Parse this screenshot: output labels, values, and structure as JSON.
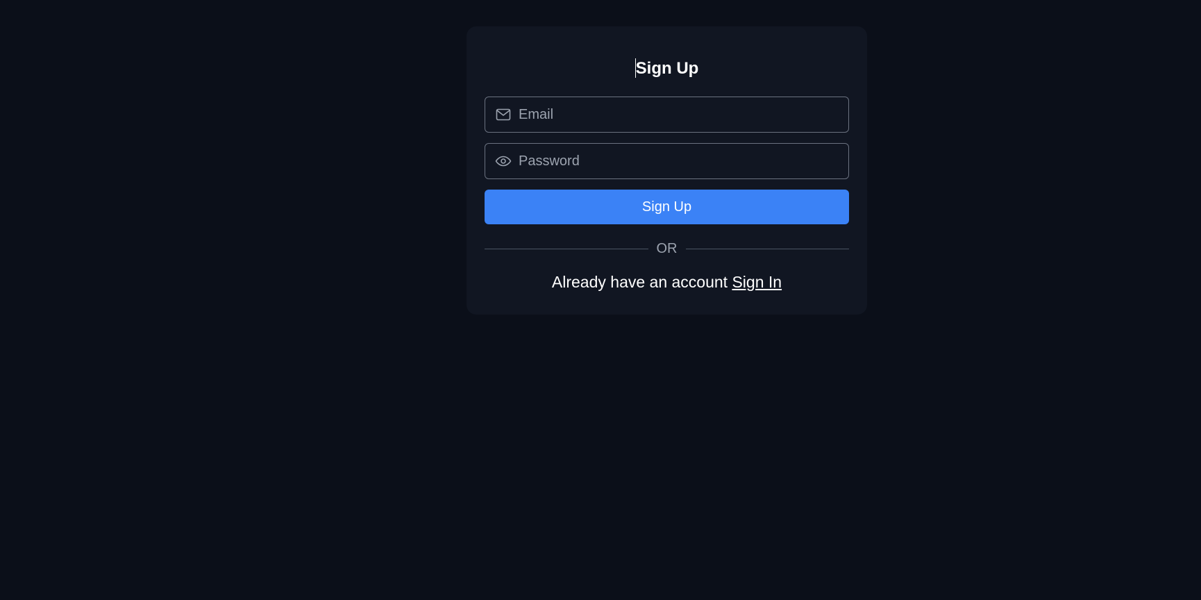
{
  "form": {
    "title": "Sign Up",
    "email": {
      "value": "",
      "placeholder": "Email",
      "icon": "mail-icon"
    },
    "password": {
      "value": "",
      "placeholder": "Password",
      "icon": "eye-icon"
    },
    "submit_label": "Sign Up",
    "divider_label": "OR",
    "footer_text": "Already have an account",
    "footer_link_label": "Sign In"
  },
  "colors": {
    "background": "#0b0f19",
    "card": "#111622",
    "accent": "#3b82f6",
    "border": "#6b7280",
    "muted_text": "#9ca3af"
  }
}
